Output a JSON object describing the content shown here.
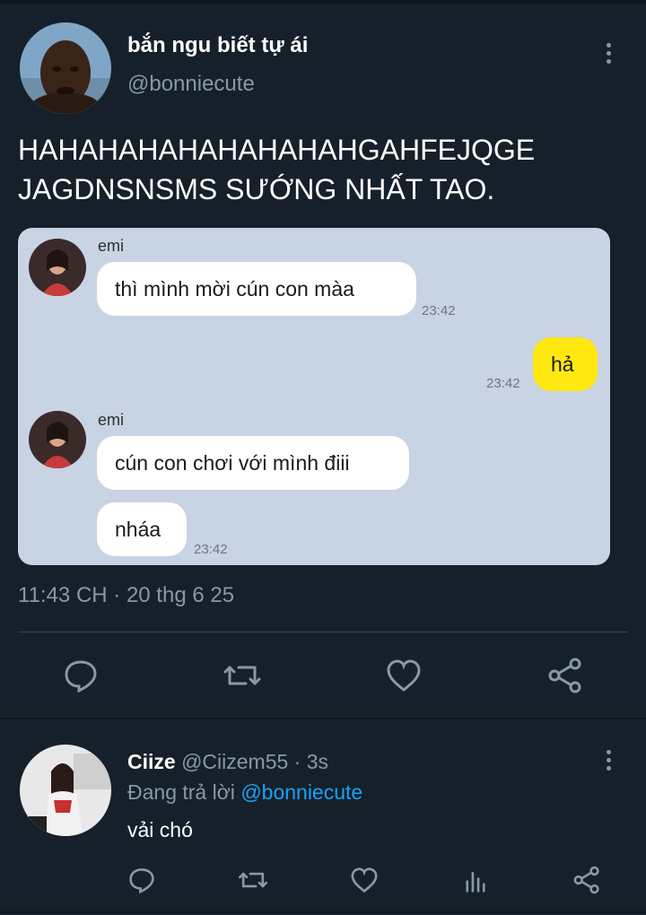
{
  "tweet": {
    "display_name": "bắn ngu biết tự ái",
    "handle": "@bonniecute",
    "text_lines": [
      "HAHAHAHAHAHAHAHAHGAHFEJQGE",
      "JAGDNSNSMS SƯỚNG NHẤT TAO."
    ],
    "timestamp": "11:43 CH · 20 thg 6 25"
  },
  "chat": {
    "messages": [
      {
        "sender": "emi",
        "text": "thì mình mời cún con màa",
        "time": "23:42"
      },
      {
        "sender": "me",
        "text": "hả",
        "time": "23:42"
      },
      {
        "sender": "emi",
        "text": "cún con chơi với mình điii",
        "time": ""
      },
      {
        "sender": "emi",
        "text": "nháa",
        "time": "23:42"
      }
    ]
  },
  "reply": {
    "display_name": "Ciize",
    "handle": "@Ciizem55",
    "age": " · 3s",
    "replying_prefix": "Đang trả lời ",
    "replying_to": "@bonniecute",
    "text": "vải chó"
  },
  "icons": {
    "actions": [
      "reply-icon",
      "retweet-icon",
      "like-icon",
      "share-icon"
    ],
    "reply_actions": [
      "reply-icon",
      "retweet-icon",
      "like-icon",
      "analytics-icon",
      "share-icon"
    ]
  },
  "colors": {
    "background": "#15202b",
    "secondary_text": "#8899a6",
    "link": "#1da1f2",
    "chat_background": "#c8d3e4",
    "my_bubble": "#ffe812"
  }
}
